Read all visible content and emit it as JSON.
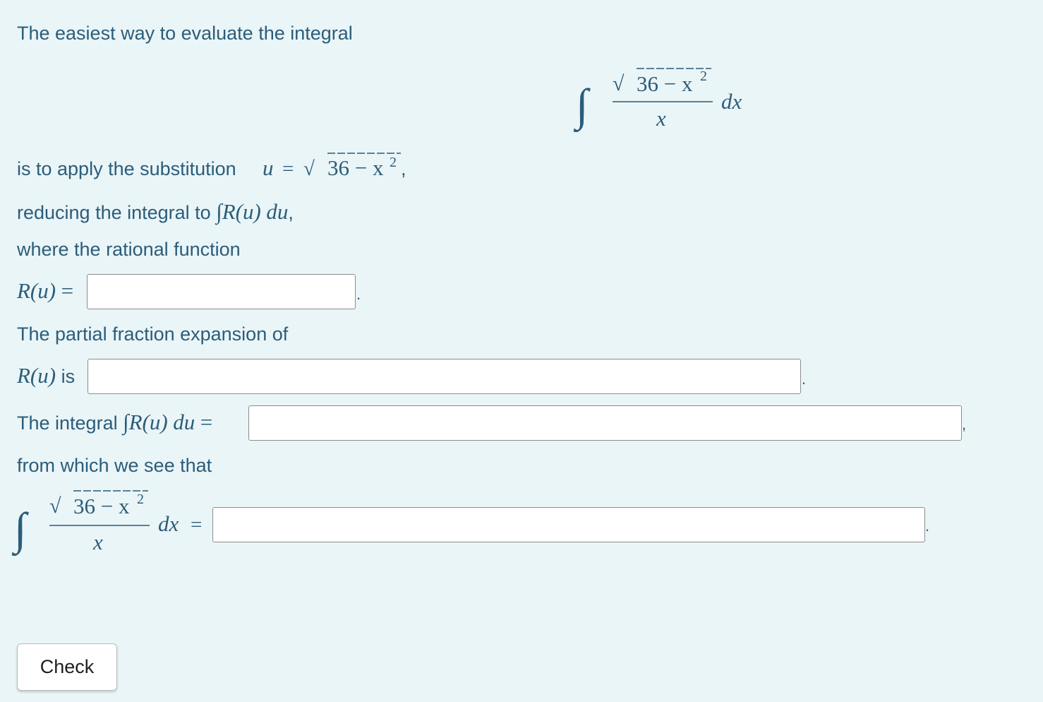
{
  "text": {
    "line1": "The easiest way to evaluate the integral",
    "line2": "is to apply the substitution",
    "line3": "reducing the integral to",
    "line4": "where the rational function",
    "line5": "The partial fraction expansion of",
    "is_word": "is",
    "line6": "The integral",
    "line7": "from which we see that"
  },
  "math": {
    "integral_sign": "∫",
    "sqrt_sign": "√",
    "radicand": "36 − x",
    "exponent": "2",
    "denominator": "x",
    "dx": "dx",
    "u_var": "u",
    "equals": "=",
    "comma": ",",
    "R_u": "R(u)",
    "du": "du"
  },
  "buttons": {
    "check": "Check"
  }
}
